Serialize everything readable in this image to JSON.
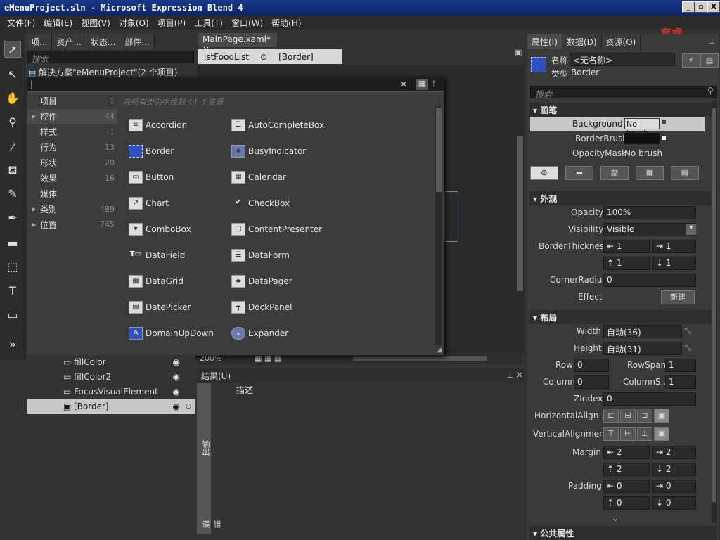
{
  "window": {
    "title": "eMenuProject.sln - Microsoft Expression Blend 4",
    "min": "_",
    "max": "▫",
    "close": "X"
  },
  "menu": [
    "文件(F)",
    "编辑(E)",
    "视图(V)",
    "对象(O)",
    "项目(P)",
    "工具(T)",
    "窗口(W)",
    "帮助(H)"
  ],
  "left_tabs": [
    "项...",
    "资产...",
    "状态...",
    "部件..."
  ],
  "left_search_placeholder": "搜索",
  "solution_label": "解决方案\"eMenuProject\"(2 个项目)",
  "document_tab": {
    "label": "MainPage.xaml*",
    "close": "×"
  },
  "breadcrumb": {
    "item1": "lstFoodList",
    "item2": "[Border]"
  },
  "popup": {
    "input_value": "|",
    "header": "在所有类别中找到 44 个资源",
    "categories": [
      {
        "label": "项目",
        "count": "1",
        "arrow": ""
      },
      {
        "label": "控件",
        "count": "44",
        "arrow": "▶"
      },
      {
        "label": "样式",
        "count": "1",
        "arrow": ""
      },
      {
        "label": "行为",
        "count": "13",
        "arrow": ""
      },
      {
        "label": "形状",
        "count": "20",
        "arrow": ""
      },
      {
        "label": "效果",
        "count": "16",
        "arrow": ""
      },
      {
        "label": "媒体",
        "count": "",
        "arrow": ""
      },
      {
        "label": "类别",
        "count": "489",
        "arrow": "▶"
      },
      {
        "label": "位置",
        "count": "745",
        "arrow": "▶"
      }
    ],
    "controls_col1": [
      "Accordion",
      "Border",
      "Button",
      "Chart",
      "ComboBox",
      "DataField",
      "DataGrid",
      "DatePicker",
      "DomainUpDown"
    ],
    "controls_col2": [
      "AutoCompleteBox",
      "BusyIndicator",
      "Calendar",
      "CheckBox",
      "ContentPresenter",
      "DataForm",
      "DataPager",
      "DockPanel",
      "Expander"
    ]
  },
  "zoom": "200%",
  "layers": [
    "fillColor",
    "fillColor2",
    "FocusVisualElement",
    "[Border]"
  ],
  "results": {
    "tab": "结果(U)",
    "column": "描述",
    "side1": "输出",
    "side2": "错误"
  },
  "right": {
    "tabs": [
      "属性(I)",
      "数据(D)",
      "资源(O)"
    ],
    "name_label": "名称",
    "name_value": "<无名称>",
    "type_label": "类型",
    "type_value": "Border",
    "search_placeholder": "搜索",
    "brush_section": "画笔",
    "brushes": [
      {
        "label": "Background",
        "value": "No brush"
      },
      {
        "label": "BorderBrush",
        "value": ""
      },
      {
        "label": "OpacityMask",
        "value": "No brush"
      }
    ],
    "appearance_section": "外观",
    "opacity_label": "Opacity",
    "opacity_value": "100%",
    "visibility_label": "Visibility",
    "visibility_value": "Visible",
    "borderthickness_label": "BorderThickness",
    "bt": [
      "1",
      "1",
      "1",
      "1"
    ],
    "cornerradius_label": "CornerRadius",
    "cornerradius_value": "0",
    "effect_label": "Effect",
    "effect_button": "新建",
    "layout_section": "布局",
    "width_label": "Width",
    "width_value": "自动(36)",
    "height_label": "Height",
    "height_value": "自动(31)",
    "row_label": "Row",
    "row_value": "0",
    "rowspan_label": "RowSpan",
    "rowspan_value": "1",
    "column_label": "Column",
    "column_value": "0",
    "columnspan_label": "ColumnS...",
    "columnspan_value": "1",
    "zindex_label": "ZIndex",
    "zindex_value": "0",
    "halign_label": "HorizontalAlign...",
    "valign_label": "VerticalAlignment",
    "margin_label": "Margin",
    "margin": [
      "2",
      "2",
      "2",
      "2"
    ],
    "padding_label": "Padding",
    "padding": [
      "0",
      "0",
      "0",
      "0"
    ],
    "common_section": "公共属性"
  },
  "logo_text": "育睿教育"
}
